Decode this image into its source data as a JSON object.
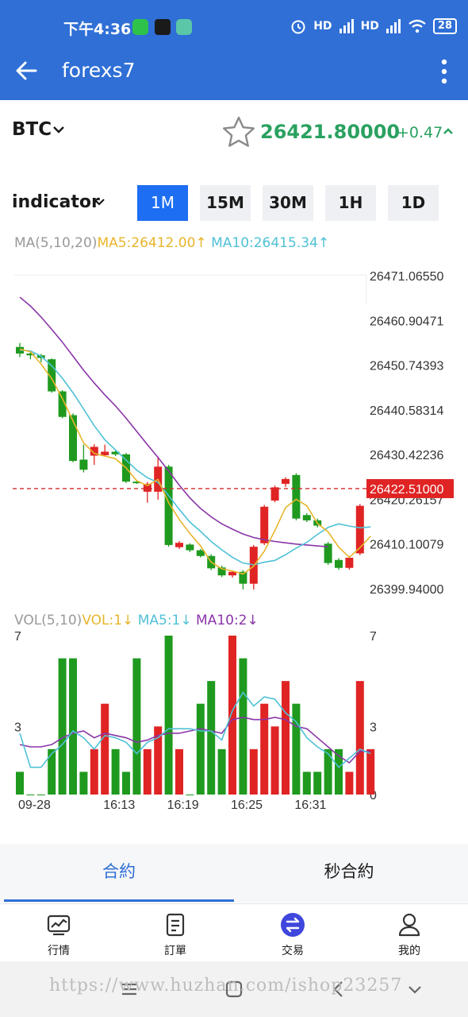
{
  "status_bar": {
    "time": "下午4:36",
    "battery": "28",
    "network": "HD"
  },
  "app_bar": {
    "title": "forexs7"
  },
  "ticker": {
    "symbol": "BTC",
    "price": "26421.80000",
    "change": "+0.47"
  },
  "indicator": {
    "label": "indicator"
  },
  "intervals": [
    {
      "label": "1M",
      "active": true
    },
    {
      "label": "15M",
      "active": false
    },
    {
      "label": "30M",
      "active": false
    },
    {
      "label": "1H",
      "active": false
    },
    {
      "label": "1D",
      "active": false
    }
  ],
  "ma_header": {
    "label": "MA(5,10,20)",
    "ma5": "MA5:26412.00",
    "ma10": "MA10:26415.34"
  },
  "vol_header": {
    "label": "VOL(5,10)",
    "vol": "VOL:1",
    "ma5": "MA5:1",
    "ma10": "MA10:2"
  },
  "chart_data": {
    "type": "candlestick",
    "price_axis": [
      "26471.06550",
      "26460.90471",
      "26450.74393",
      "26440.58314",
      "26430.42236",
      "26420.26157",
      "26410.10079",
      "26399.94000"
    ],
    "price_range": [
      26399.94,
      26471.0655
    ],
    "current_price_label": "26422.51000",
    "current_price": 26422.51,
    "volume_axis": [
      "7",
      "3",
      "0"
    ],
    "volume_range": [
      0,
      7
    ],
    "time_labels": [
      "09-28",
      "16:13",
      "16:19",
      "16:25",
      "16:31"
    ],
    "candles": [
      {
        "o": 26454.7,
        "c": 26453.2,
        "h": 26455.6,
        "l": 26452.4
      },
      {
        "o": 26453.2,
        "c": 26452.8,
        "h": 26453.6,
        "l": 26451.9
      },
      {
        "o": 26452.8,
        "c": 26452.2,
        "h": 26453.1,
        "l": 26451.2
      },
      {
        "o": 26451.9,
        "c": 26444.6,
        "h": 26452.1,
        "l": 26444.3
      },
      {
        "o": 26444.6,
        "c": 26438.8,
        "h": 26444.9,
        "l": 26438.5
      },
      {
        "o": 26439.2,
        "c": 26428.8,
        "h": 26439.6,
        "l": 26428.5
      },
      {
        "o": 26429.1,
        "c": 26426.8,
        "h": 26432.5,
        "l": 26426.2
      },
      {
        "o": 26430.0,
        "c": 26432.0,
        "h": 26432.6,
        "l": 26427.9
      },
      {
        "o": 26430.1,
        "c": 26430.9,
        "h": 26432.5,
        "l": 26429.8
      },
      {
        "o": 26430.9,
        "c": 26430.3,
        "h": 26431.1,
        "l": 26429.9
      },
      {
        "o": 26430.3,
        "c": 26424.1,
        "h": 26430.6,
        "l": 26423.8
      },
      {
        "o": 26424.1,
        "c": 26423.9,
        "h": 26424.4,
        "l": 26423.6
      },
      {
        "o": 26421.8,
        "c": 26423.6,
        "h": 26424.0,
        "l": 26419.3
      },
      {
        "o": 26421.8,
        "c": 26427.5,
        "h": 26429.8,
        "l": 26420.0
      },
      {
        "o": 26427.5,
        "c": 26409.7,
        "h": 26427.9,
        "l": 26409.3
      },
      {
        "o": 26409.2,
        "c": 26410.2,
        "h": 26410.6,
        "l": 26408.8
      },
      {
        "o": 26409.8,
        "c": 26408.5,
        "h": 26410.1,
        "l": 26408.1
      },
      {
        "o": 26408.5,
        "c": 26407.2,
        "h": 26408.8,
        "l": 26406.9
      },
      {
        "o": 26407.2,
        "c": 26404.4,
        "h": 26407.6,
        "l": 26404.0
      },
      {
        "o": 26404.6,
        "c": 26402.8,
        "h": 26405.0,
        "l": 26402.4
      },
      {
        "o": 26402.8,
        "c": 26403.6,
        "h": 26403.9,
        "l": 26402.3
      },
      {
        "o": 26403.6,
        "c": 26400.9,
        "h": 26404.0,
        "l": 26399.6
      },
      {
        "o": 26400.9,
        "c": 26409.3,
        "h": 26409.7,
        "l": 26399.6
      },
      {
        "o": 26410.1,
        "c": 26418.4,
        "h": 26418.8,
        "l": 26409.7
      },
      {
        "o": 26419.8,
        "c": 26422.8,
        "h": 26423.2,
        "l": 26419.4
      },
      {
        "o": 26423.6,
        "c": 26424.7,
        "h": 26425.1,
        "l": 26422.9
      },
      {
        "o": 26425.6,
        "c": 26415.7,
        "h": 26426.0,
        "l": 26415.3
      },
      {
        "o": 26416.5,
        "c": 26415.3,
        "h": 26416.9,
        "l": 26414.9
      },
      {
        "o": 26415.3,
        "c": 26414.1,
        "h": 26415.7,
        "l": 26413.7
      },
      {
        "o": 26410.0,
        "c": 26405.6,
        "h": 26410.4,
        "l": 26405.2
      },
      {
        "o": 26406.3,
        "c": 26404.5,
        "h": 26406.7,
        "l": 26404.1
      },
      {
        "o": 26404.5,
        "c": 26406.8,
        "h": 26407.2,
        "l": 26404.1
      },
      {
        "o": 26407.8,
        "c": 26418.6,
        "h": 26419.0,
        "l": 26407.4
      },
      {
        "o": 26420.5,
        "c": 26422.2,
        "h": 26422.6,
        "l": 26420.1
      }
    ],
    "volumes": [
      1,
      0,
      0,
      2,
      6,
      6,
      1,
      2,
      4,
      2,
      1,
      6,
      2,
      3,
      7,
      2,
      0,
      4,
      5,
      2,
      7,
      6,
      2,
      4,
      3,
      5,
      4,
      1,
      1,
      2,
      2,
      1,
      5,
      2
    ],
    "ma5": [
      26454.2,
      26453.6,
      26450.8,
      26447.5,
      26443.0,
      26437.9,
      26432.9,
      26430.5,
      26429.9,
      26429.3,
      26427.2,
      26424.3,
      26423.2,
      26424.6,
      26419.3,
      26415.5,
      26412.3,
      26409.5,
      26405.8,
      26404.3,
      26403.8,
      26403.1,
      26404.9,
      26408.3,
      26413.0,
      26418.2,
      26420.1,
      26418.6,
      26414.6,
      26412.7,
      26409.2,
      26406.9,
      26409.1,
      26411.7
    ],
    "ma10": [
      26454.0,
      26453.8,
      26452.6,
      26450.4,
      26447.6,
      26444.3,
      26440.6,
      26436.8,
      26433.6,
      26431.3,
      26429.0,
      26426.7,
      26425.0,
      26423.9,
      26420.9,
      26417.8,
      26414.9,
      26412.8,
      26410.5,
      26408.6,
      26406.9,
      26405.6,
      26405.2,
      26405.8,
      26406.2,
      26407.5,
      26409.0,
      26410.3,
      26412.1,
      26413.7,
      26414.5,
      26414.0,
      26413.6,
      26413.8
    ],
    "ma20": [
      26466.0,
      26464.0,
      26461.5,
      26458.7,
      26455.8,
      26452.6,
      26449.4,
      26446.5,
      26443.8,
      26441.3,
      26438.5,
      26435.5,
      26432.5,
      26429.6,
      26426.5,
      26423.3,
      26420.4,
      26418.0,
      26416.1,
      26414.5,
      26413.3,
      26412.2,
      26411.4,
      26410.9,
      26410.5,
      26410.2,
      26409.9,
      26409.7,
      26409.5,
      26409.3
    ],
    "vol_ma5": [
      2.7,
      1.2,
      1.2,
      1.8,
      2.2,
      2.8,
      2.5,
      2.0,
      2.6,
      2.5,
      2.3,
      1.8,
      2.3,
      2.5,
      2.9,
      2.9,
      2.9,
      2.8,
      2.8,
      2.4,
      3.7,
      4.5,
      3.9,
      4.3,
      4.2,
      3.6,
      3.2,
      2.5,
      2.1,
      1.8,
      1.2,
      1.6,
      2.0,
      1.8
    ],
    "vol_ma10": [
      2.2,
      2.1,
      2.1,
      2.2,
      2.5,
      2.7,
      2.8,
      2.5,
      2.7,
      2.6,
      2.5,
      2.3,
      2.4,
      2.6,
      2.7,
      2.7,
      2.8,
      2.9,
      2.8,
      2.7,
      3.3,
      3.4,
      3.3,
      3.3,
      3.4,
      3.3,
      3.0,
      2.9,
      2.5,
      2.1,
      1.7,
      1.4,
      1.9,
      1.9
    ]
  },
  "contract_tabs": [
    {
      "label": "合約",
      "active": true
    },
    {
      "label": "秒合約",
      "active": false
    }
  ],
  "nav": [
    {
      "label": "行情",
      "icon": "chart-icon"
    },
    {
      "label": "訂單",
      "icon": "document-icon"
    },
    {
      "label": "交易",
      "icon": "exchange-icon",
      "active": true
    },
    {
      "label": "我的",
      "icon": "user-icon"
    }
  ],
  "watermark": "https://www.huzhan.com/ishop23257",
  "colors": {
    "up": "#e02424",
    "down": "#1f9a1f",
    "accent": "#2f6fd6",
    "ma5": "#e7b52b",
    "ma10": "#4fc1d6",
    "ma20": "#8a35a8"
  }
}
